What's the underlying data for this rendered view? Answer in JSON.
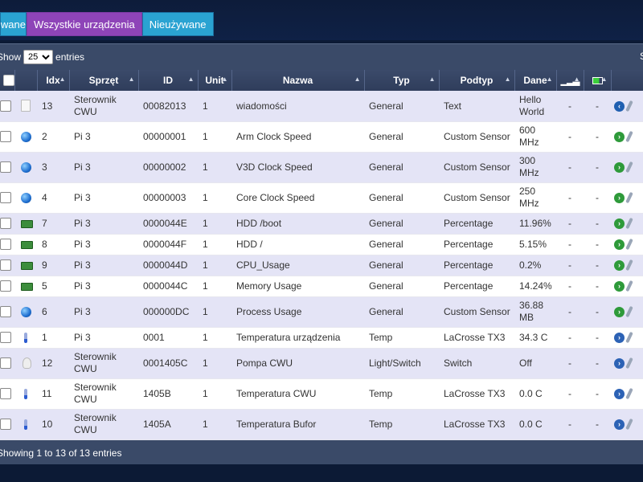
{
  "tabs": [
    {
      "label": "Używane"
    },
    {
      "label": "Wszystkie urządzenia"
    },
    {
      "label": "Nieużywane"
    }
  ],
  "length_menu": {
    "prefix": "Show",
    "value": "25",
    "options": [
      "25"
    ],
    "suffix": "entries"
  },
  "search_label": "S",
  "columns": [
    "Idx",
    "Sprzęt",
    "ID",
    "Unit",
    "Nazwa",
    "Typ",
    "Podtyp",
    "Dane"
  ],
  "rows": [
    {
      "icon": "document-icon",
      "idx": "13",
      "hw": "Sterownik CWU",
      "id": "00082013",
      "unit": "1",
      "name": "wiadomości",
      "type": "General",
      "subtype": "Text",
      "data": "Hello World",
      "sig": "-",
      "bat": "-",
      "action": "log"
    },
    {
      "icon": "globe-icon",
      "idx": "2",
      "hw": "Pi 3",
      "id": "00000001",
      "unit": "1",
      "name": "Arm Clock Speed",
      "type": "General",
      "subtype": "Custom Sensor",
      "data": "600 MHz",
      "sig": "-",
      "bat": "-",
      "action": "green"
    },
    {
      "icon": "globe-icon",
      "idx": "3",
      "hw": "Pi 3",
      "id": "00000002",
      "unit": "1",
      "name": "V3D Clock Speed",
      "type": "General",
      "subtype": "Custom Sensor",
      "data": "300 MHz",
      "sig": "-",
      "bat": "-",
      "action": "green"
    },
    {
      "icon": "globe-icon",
      "idx": "4",
      "hw": "Pi 3",
      "id": "00000003",
      "unit": "1",
      "name": "Core Clock Speed",
      "type": "General",
      "subtype": "Custom Sensor",
      "data": "250 MHz",
      "sig": "-",
      "bat": "-",
      "action": "green"
    },
    {
      "icon": "board-icon",
      "idx": "7",
      "hw": "Pi 3",
      "id": "0000044E",
      "unit": "1",
      "name": "HDD /boot",
      "type": "General",
      "subtype": "Percentage",
      "data": "11.96%",
      "sig": "-",
      "bat": "-",
      "action": "green"
    },
    {
      "icon": "board-icon",
      "idx": "8",
      "hw": "Pi 3",
      "id": "0000044F",
      "unit": "1",
      "name": "HDD /",
      "type": "General",
      "subtype": "Percentage",
      "data": "5.15%",
      "sig": "-",
      "bat": "-",
      "action": "green"
    },
    {
      "icon": "board-icon",
      "idx": "9",
      "hw": "Pi 3",
      "id": "0000044D",
      "unit": "1",
      "name": "CPU_Usage",
      "type": "General",
      "subtype": "Percentage",
      "data": "0.2%",
      "sig": "-",
      "bat": "-",
      "action": "green"
    },
    {
      "icon": "board-icon",
      "idx": "5",
      "hw": "Pi 3",
      "id": "0000044C",
      "unit": "1",
      "name": "Memory Usage",
      "type": "General",
      "subtype": "Percentage",
      "data": "14.24%",
      "sig": "-",
      "bat": "-",
      "action": "green"
    },
    {
      "icon": "globe-icon",
      "idx": "6",
      "hw": "Pi 3",
      "id": "000000DC",
      "unit": "1",
      "name": "Process Usage",
      "type": "General",
      "subtype": "Custom Sensor",
      "data": "36.88 MB",
      "sig": "-",
      "bat": "-",
      "action": "green"
    },
    {
      "icon": "thermometer-icon",
      "idx": "1",
      "hw": "Pi 3",
      "id": "0001",
      "unit": "1",
      "name": "Temperatura urządzenia",
      "type": "Temp",
      "subtype": "LaCrosse TX3",
      "data": "34.3 C",
      "sig": "-",
      "bat": "-",
      "action": "blue"
    },
    {
      "icon": "bulb-icon",
      "idx": "12",
      "hw": "Sterownik CWU",
      "id": "0001405C",
      "unit": "1",
      "name": "Pompa CWU",
      "type": "Light/Switch",
      "subtype": "Switch",
      "data": "Off",
      "sig": "-",
      "bat": "-",
      "action": "blue"
    },
    {
      "icon": "thermometer-icon",
      "idx": "11",
      "hw": "Sterownik CWU",
      "id": "1405B",
      "unit": "1",
      "name": "Temperatura CWU",
      "type": "Temp",
      "subtype": "LaCrosse TX3",
      "data": "0.0 C",
      "sig": "-",
      "bat": "-",
      "action": "blue"
    },
    {
      "icon": "thermometer-icon",
      "idx": "10",
      "hw": "Sterownik CWU",
      "id": "1405A",
      "unit": "1",
      "name": "Temperatura Bufor",
      "type": "Temp",
      "subtype": "LaCrosse TX3",
      "data": "0.0 C",
      "sig": "-",
      "bat": "-",
      "action": "blue"
    }
  ],
  "footer": "Showing 1 to 13 of 13 entries"
}
